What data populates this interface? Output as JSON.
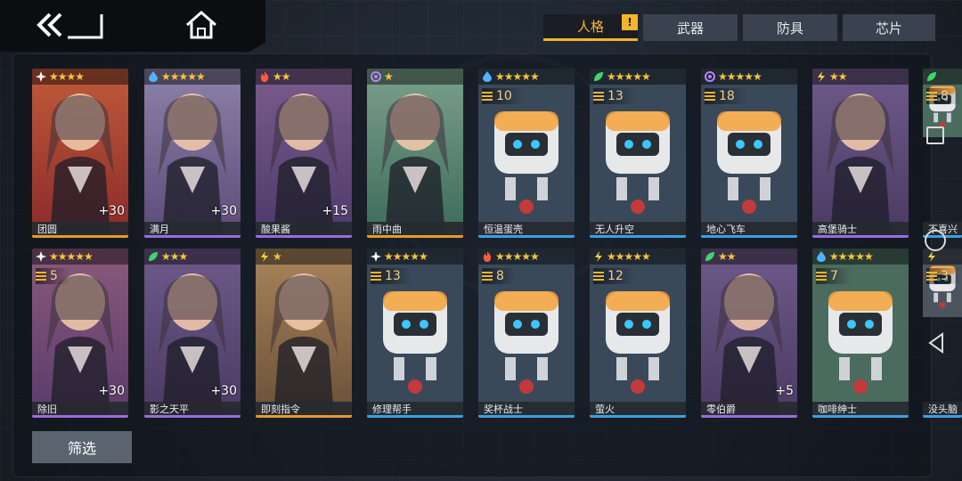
{
  "tabs": [
    {
      "label": "人格",
      "active": true,
      "alert": "!"
    },
    {
      "label": "武器",
      "active": false
    },
    {
      "label": "防具",
      "active": false
    },
    {
      "label": "芯片",
      "active": false
    }
  ],
  "filter_label": "筛选",
  "colors": {
    "accent": "#f4b52c",
    "rarity_orange": "#e69a2c",
    "rarity_purple": "#9a6bdc",
    "rarity_blue": "#3b9fe0"
  },
  "cards": [
    {
      "name": "团圆",
      "element": "star-icon",
      "stars": 4,
      "plus": "+30",
      "level": "",
      "rarity": "orange",
      "bg": [
        "#8a2a2a",
        "#c05a3a"
      ],
      "kind": "human"
    },
    {
      "name": "满月",
      "element": "water-icon",
      "stars": 5,
      "plus": "+30",
      "level": "",
      "rarity": "purple",
      "bg": [
        "#5c4a78",
        "#8c82a8"
      ],
      "kind": "human"
    },
    {
      "name": "酸果酱",
      "element": "fire-icon",
      "stars": 2,
      "plus": "+15",
      "level": "",
      "rarity": "purple",
      "bg": [
        "#4d3a6a",
        "#7a5c8c"
      ],
      "kind": "human"
    },
    {
      "name": "雨中曲",
      "element": "spiral-icon",
      "stars": 1,
      "plus": "",
      "level": "",
      "rarity": "orange",
      "bg": [
        "#3d6a5a",
        "#7aa08c"
      ],
      "kind": "human"
    },
    {
      "name": "恒温蛋壳",
      "element": "water-icon",
      "stars": 5,
      "plus": "",
      "level": "10",
      "rarity": "blue",
      "bg": [
        "#2f3d4d",
        "#45566a"
      ],
      "kind": "robot"
    },
    {
      "name": "无人升空",
      "element": "leaf-icon",
      "stars": 5,
      "plus": "",
      "level": "13",
      "rarity": "blue",
      "bg": [
        "#2f3d4d",
        "#45566a"
      ],
      "kind": "robot"
    },
    {
      "name": "地心飞车",
      "element": "spiral-icon",
      "stars": 5,
      "plus": "",
      "level": "18",
      "rarity": "blue",
      "bg": [
        "#2f3d4d",
        "#45566a"
      ],
      "kind": "robot"
    },
    {
      "name": "高堡骑士",
      "element": "bolt-icon",
      "stars": 2,
      "plus": "",
      "level": "",
      "rarity": "purple",
      "bg": [
        "#4a3a62",
        "#6e5a8a"
      ],
      "kind": "human"
    },
    {
      "name": "不喜兴",
      "element": "leaf-icon",
      "stars": 0,
      "plus": "",
      "level": "8",
      "rarity": "blue",
      "bg": [
        "#3b5c52",
        "#5a7e70"
      ],
      "kind": "robot"
    },
    {
      "name": "除旧",
      "element": "star-icon",
      "stars": 5,
      "plus": "+30",
      "level": "5",
      "rarity": "purple",
      "bg": [
        "#5a3b6a",
        "#8a5a7c"
      ],
      "kind": "human"
    },
    {
      "name": "影之天平",
      "element": "leaf-icon",
      "stars": 3,
      "plus": "+30",
      "level": "",
      "rarity": "purple",
      "bg": [
        "#4a3a62",
        "#6e5a8a"
      ],
      "kind": "human"
    },
    {
      "name": "即刻指令",
      "element": "bolt-icon",
      "stars": 1,
      "plus": "",
      "level": "",
      "rarity": "orange",
      "bg": [
        "#6a5038",
        "#a8845a"
      ],
      "kind": "human"
    },
    {
      "name": "修理帮手",
      "element": "star-icon",
      "stars": 5,
      "plus": "",
      "level": "13",
      "rarity": "blue",
      "bg": [
        "#2f3d4d",
        "#45566a"
      ],
      "kind": "robot"
    },
    {
      "name": "奖杯战士",
      "element": "fire-icon",
      "stars": 5,
      "plus": "",
      "level": "8",
      "rarity": "blue",
      "bg": [
        "#2f3d4d",
        "#45566a"
      ],
      "kind": "robot"
    },
    {
      "name": "萤火",
      "element": "bolt-icon",
      "stars": 5,
      "plus": "",
      "level": "12",
      "rarity": "blue",
      "bg": [
        "#2f3d4d",
        "#45566a"
      ],
      "kind": "robot"
    },
    {
      "name": "零伯爵",
      "element": "leaf-icon",
      "stars": 2,
      "plus": "+5",
      "level": "",
      "rarity": "purple",
      "bg": [
        "#4a3a62",
        "#6e5a8a"
      ],
      "kind": "human"
    },
    {
      "name": "咖啡绅士",
      "element": "water-icon",
      "stars": 5,
      "plus": "",
      "level": "7",
      "rarity": "blue",
      "bg": [
        "#3b5c52",
        "#5a7e70"
      ],
      "kind": "robot"
    },
    {
      "name": "没头脑",
      "element": "bolt-icon",
      "stars": 0,
      "plus": "",
      "level": "3",
      "rarity": "blue",
      "bg": [
        "#3a4450",
        "#5a6470"
      ],
      "kind": "robot"
    }
  ]
}
